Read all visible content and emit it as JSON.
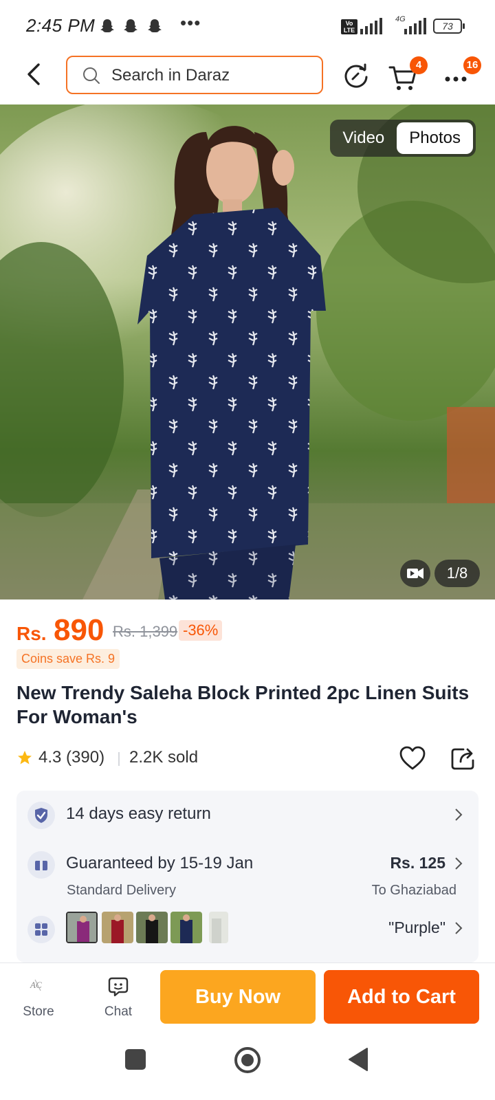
{
  "status_bar": {
    "time": "2:45 PM",
    "dots": "•••",
    "volte": "Vo LTE",
    "network": "4G",
    "battery": "73"
  },
  "header": {
    "search_placeholder": "Search in Daraz",
    "cart_count": "4",
    "more_count": "16"
  },
  "gallery": {
    "tabs": [
      "Video",
      "Photos"
    ],
    "active_tab": "Photos",
    "counter": "1/8"
  },
  "product": {
    "currency": "Rs.",
    "price": "890",
    "original_price": "Rs. 1,399",
    "discount": "-36%",
    "coins": "Coins save Rs. 9",
    "title": "New Trendy Saleha Block Printed 2pc Linen Suits For Woman's",
    "rating": "4.3 (390)",
    "sold": "2.2K sold"
  },
  "service": {
    "return_label": "14 days easy return",
    "delivery_label": "Guaranteed by 15-19 Jan",
    "delivery_type": "Standard Delivery",
    "delivery_fee": "Rs. 125",
    "delivery_to": "To Ghaziabad",
    "variant_selected": "\"Purple\"",
    "variant_thumbnails": 5
  },
  "bottom_bar": {
    "store_label": "Store",
    "chat_label": "Chat",
    "buy_now": "Buy Now",
    "add_to_cart": "Add to Cart"
  },
  "colors": {
    "accent": "#f85606",
    "buy_now": "#fca61f",
    "search_border": "#f57224"
  }
}
